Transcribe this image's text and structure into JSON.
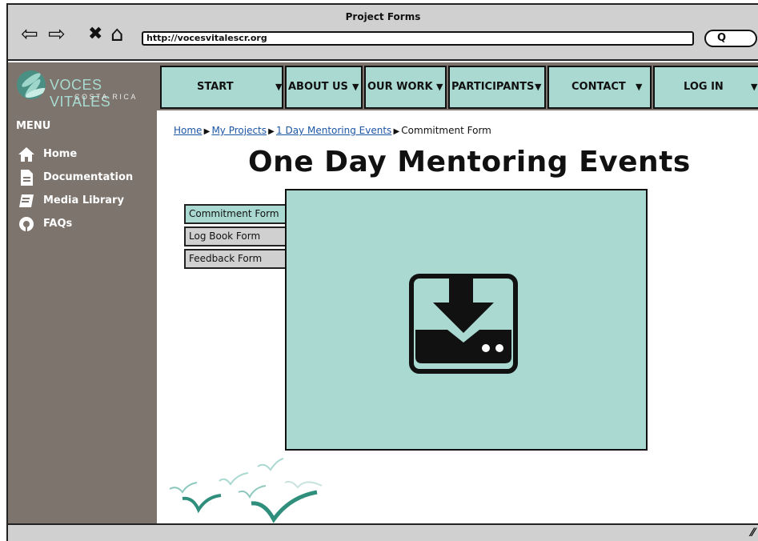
{
  "browser": {
    "window_title": "Project Forms",
    "url": "http://vocesvitalescr.org",
    "search_label": "Q",
    "icons": [
      "back-arrow-icon",
      "forward-arrow-icon",
      "close-icon",
      "home-icon",
      "search-icon"
    ]
  },
  "logo": {
    "title": "VOCES VITALES",
    "subtitle": "COSTA RICA"
  },
  "top_nav": [
    {
      "label": "START"
    },
    {
      "label": "ABOUT US"
    },
    {
      "label": "OUR WORK"
    },
    {
      "label": "PARTICIPANTS"
    },
    {
      "label": "CONTACT"
    },
    {
      "label": "LOG IN"
    }
  ],
  "sidebar": {
    "title": "MENU",
    "items": [
      {
        "label": "Home",
        "icon": "home-icon"
      },
      {
        "label": "Documentation",
        "icon": "document-icon"
      },
      {
        "label": "Media Library",
        "icon": "media-library-icon"
      },
      {
        "label": "FAQs",
        "icon": "help-icon"
      }
    ]
  },
  "breadcrumb": {
    "items": [
      "Home",
      "My Projects",
      "1 Day Mentoring Events"
    ],
    "current": "Commitment Form"
  },
  "page": {
    "title": "One Day Mentoring Events"
  },
  "form_tabs": [
    {
      "label": "Commitment Form",
      "active": true
    },
    {
      "label": "Log Book Form",
      "active": false
    },
    {
      "label": "Feedback Form",
      "active": false
    }
  ],
  "content": {
    "icon": "download-icon"
  },
  "colors": {
    "accent": "#a9d9d0",
    "sidebar": "#7d746d",
    "chrome": "#d0d0d0",
    "link": "#1d56a5"
  }
}
